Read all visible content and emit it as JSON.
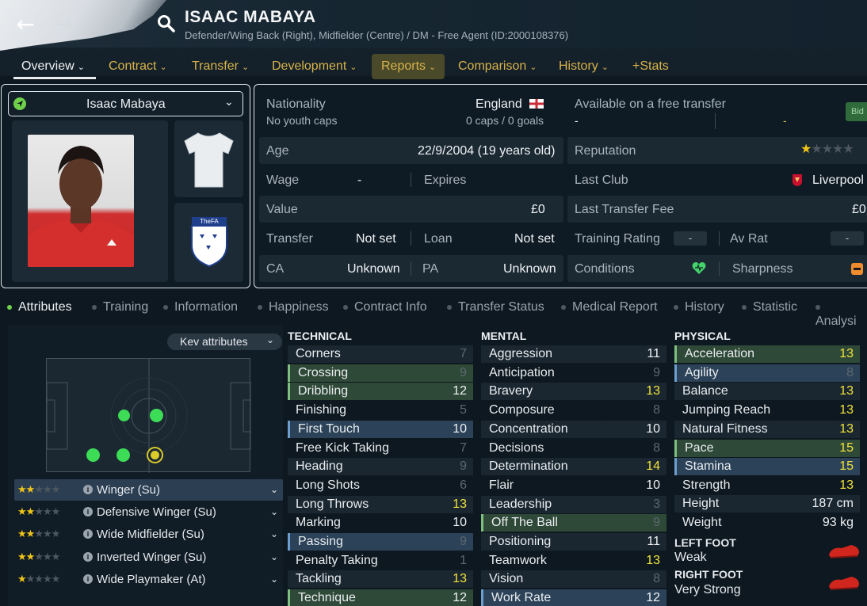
{
  "header": {
    "name": "ISAAC MABAYA",
    "subtitle": "Defender/Wing Back (Right), Midfielder (Centre) / DM - Free Agent (ID:2000108376)"
  },
  "nav": {
    "back_icon": "←",
    "forward_icon": "→",
    "search_icon": "search-icon"
  },
  "tabs": [
    {
      "label": "Overview"
    },
    {
      "label": "Contract"
    },
    {
      "label": "Transfer"
    },
    {
      "label": "Development"
    },
    {
      "label": "Reports"
    },
    {
      "label": "Comparison"
    },
    {
      "label": "History"
    },
    {
      "label": "+Stats"
    }
  ],
  "player_select": {
    "value": "Isaac Mabaya"
  },
  "info": {
    "nationality_label": "Nationality",
    "nationality": "England",
    "youth_caps": "No youth caps",
    "caps_goals": "0 caps / 0 goals",
    "available_label": "Available on a free transfer",
    "available_left": "-",
    "available_right": "-",
    "bid_label": "Bid",
    "age_label": "Age",
    "age": "22/9/2004 (19 years old)",
    "reputation_label": "Reputation",
    "wage_label": "Wage",
    "wage": "-",
    "expires_label": "Expires",
    "last_club_label": "Last Club",
    "last_club": "Liverpool",
    "value_label": "Value",
    "value": "£0",
    "last_fee_label": "Last Transfer Fee",
    "last_fee": "£0",
    "transfer_label": "Transfer",
    "transfer": "Not set",
    "loan_label": "Loan",
    "loan": "Not set",
    "training_label": "Training Rating",
    "training": "-",
    "avrat_label": "Av Rat",
    "avrat": "-",
    "ca_label": "CA",
    "ca": "Unknown",
    "pa_label": "PA",
    "pa": "Unknown",
    "conditions_label": "Conditions",
    "sharpness_label": "Sharpness"
  },
  "subtabs": [
    {
      "label": "Attributes"
    },
    {
      "label": "Training"
    },
    {
      "label": "Information"
    },
    {
      "label": "Happiness"
    },
    {
      "label": "Contract Info"
    },
    {
      "label": "Transfer Status"
    },
    {
      "label": "Medical Report"
    },
    {
      "label": "History"
    },
    {
      "label": "Statistic"
    },
    {
      "label": "Analysi"
    }
  ],
  "key_attributes_label": "Kev attributes",
  "positions": [
    {
      "name": "Winger (Su)",
      "stars": "★★☆☆☆"
    },
    {
      "name": "Defensive Winger (Su)",
      "stars": "★★☆☆☆"
    },
    {
      "name": "Wide Midfielder (Su)",
      "stars": "★★☆☆☆"
    },
    {
      "name": "Inverted Winger (Su)",
      "stars": "★★☆☆☆"
    },
    {
      "name": "Wide Playmaker (At)",
      "stars": "★½☆☆☆"
    }
  ],
  "technical_title": "TECHNICAL",
  "technical": [
    {
      "n": "Corners",
      "v": "7"
    },
    {
      "n": "Crossing",
      "v": "9"
    },
    {
      "n": "Dribbling",
      "v": "12"
    },
    {
      "n": "Finishing",
      "v": "5"
    },
    {
      "n": "First Touch",
      "v": "10"
    },
    {
      "n": "Free Kick Taking",
      "v": "7"
    },
    {
      "n": "Heading",
      "v": "9"
    },
    {
      "n": "Long Shots",
      "v": "6"
    },
    {
      "n": "Long Throws",
      "v": "13"
    },
    {
      "n": "Marking",
      "v": "10"
    },
    {
      "n": "Passing",
      "v": "9"
    },
    {
      "n": "Penalty Taking",
      "v": "1"
    },
    {
      "n": "Tackling",
      "v": "13"
    },
    {
      "n": "Technique",
      "v": "12"
    }
  ],
  "mental_title": "MENTAL",
  "mental": [
    {
      "n": "Aggression",
      "v": "11"
    },
    {
      "n": "Anticipation",
      "v": "9"
    },
    {
      "n": "Bravery",
      "v": "13"
    },
    {
      "n": "Composure",
      "v": "8"
    },
    {
      "n": "Concentration",
      "v": "10"
    },
    {
      "n": "Decisions",
      "v": "8"
    },
    {
      "n": "Determination",
      "v": "14"
    },
    {
      "n": "Flair",
      "v": "10"
    },
    {
      "n": "Leadership",
      "v": "3"
    },
    {
      "n": "Off The Ball",
      "v": "9"
    },
    {
      "n": "Positioning",
      "v": "11"
    },
    {
      "n": "Teamwork",
      "v": "13"
    },
    {
      "n": "Vision",
      "v": "8"
    },
    {
      "n": "Work Rate",
      "v": "12"
    }
  ],
  "physical_title": "PHYSICAL",
  "physical": [
    {
      "n": "Acceleration",
      "v": "13"
    },
    {
      "n": "Agility",
      "v": "8"
    },
    {
      "n": "Balance",
      "v": "13"
    },
    {
      "n": "Jumping Reach",
      "v": "13"
    },
    {
      "n": "Natural Fitness",
      "v": "13"
    },
    {
      "n": "Pace",
      "v": "15"
    },
    {
      "n": "Stamina",
      "v": "15"
    },
    {
      "n": "Strength",
      "v": "13"
    }
  ],
  "height_label": "Height",
  "height": "187 cm",
  "weight_label": "Weight",
  "weight": "93 kg",
  "left_foot_title": "LEFT FOOT",
  "left_foot": "Weak",
  "right_foot_title": "RIGHT FOOT",
  "right_foot": "Very Strong",
  "colors": {
    "accent_yellow": "#d8b34a",
    "highlight_green": "#2f4938",
    "highlight_blue": "#2c4258",
    "value_yellow": "#f1e23a"
  }
}
